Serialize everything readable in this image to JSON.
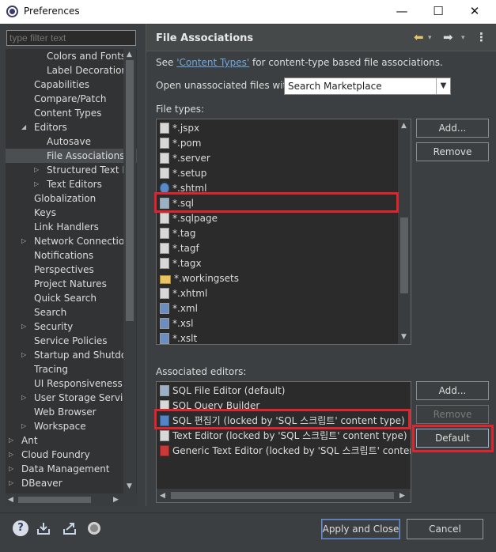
{
  "window": {
    "title": "Preferences",
    "minimize": "—",
    "maximize": "☐",
    "close": "✕"
  },
  "filter": {
    "placeholder": "type filter text"
  },
  "tree": [
    "Colors and Fonts",
    "Label Decorations",
    "Capabilities",
    "Compare/Patch",
    "Content Types",
    "Editors",
    "Autosave",
    "File Associations",
    "Structured Text Ed",
    "Text Editors",
    "Globalization",
    "Keys",
    "Link Handlers",
    "Network Connection",
    "Notifications",
    "Perspectives",
    "Project Natures",
    "Quick Search",
    "Search",
    "Security",
    "Service Policies",
    "Startup and Shutdow",
    "Tracing",
    "UI Responsiveness M",
    "User Storage Service",
    "Web Browser",
    "Workspace",
    "Ant",
    "Cloud Foundry",
    "Data Management",
    "DBeaver"
  ],
  "page": {
    "title": "File Associations",
    "see_prefix": "See ",
    "content_types_link": "'Content Types'",
    "see_suffix": " for content-type based file associations.",
    "open_unassociated_label": "Open unassociated files with:",
    "open_unassociated_value": "Search Marketplace",
    "file_types_label": "File types:",
    "associated_editors_label": "Associated editors:"
  },
  "file_types": [
    "*.jspx",
    "*.pom",
    "*.server",
    "*.setup",
    "*.shtml",
    "*.sql",
    "*.sqlpage",
    "*.tag",
    "*.tagf",
    "*.tagx",
    "*.workingsets",
    "*.xhtml",
    "*.xml",
    "*.xsl",
    "*.xslt"
  ],
  "file_type_buttons": {
    "add": "Add...",
    "remove": "Remove"
  },
  "editors": [
    "SQL File Editor (default)",
    "SQL Query Builder",
    "SQL 편집기 (locked by 'SQL 스크립트' content type)",
    "Text Editor (locked by 'SQL 스크립트' content type)",
    "Generic Text Editor (locked by 'SQL 스크립트' content t"
  ],
  "editor_buttons": {
    "add": "Add...",
    "remove": "Remove",
    "default": "Default"
  },
  "footer": {
    "apply_close": "Apply and Close",
    "cancel": "Cancel"
  },
  "colors": {
    "highlight": "#e0242d",
    "background": "#3c3f41"
  }
}
